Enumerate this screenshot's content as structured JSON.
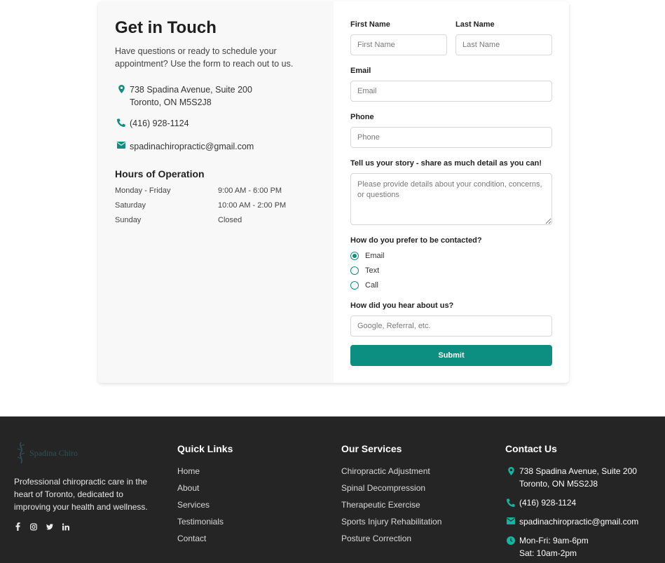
{
  "contact_info": {
    "title": "Get in Touch",
    "intro": "Have questions or ready to schedule your appointment? Use the form to reach out to us.",
    "address_line1": "738 Spadina Avenue, Suite 200",
    "address_line2": "Toronto, ON M5S2J8",
    "phone": "(416) 928-1124",
    "email": "spadinachiropractic@gmail.com",
    "hours_title": "Hours of Operation",
    "hours": [
      {
        "day": "Monday - Friday",
        "time": "9:00 AM - 6:00 PM"
      },
      {
        "day": "Saturday",
        "time": "10:00 AM - 2:00 PM"
      },
      {
        "day": "Sunday",
        "time": "Closed"
      }
    ],
    "icons": {
      "address": "map-pin-icon",
      "phone": "phone-icon",
      "email": "envelope-icon"
    }
  },
  "form": {
    "first_name": {
      "label": "First Name",
      "placeholder": "First Name",
      "value": ""
    },
    "last_name": {
      "label": "Last Name",
      "placeholder": "Last Name",
      "value": ""
    },
    "email": {
      "label": "Email",
      "placeholder": "Email",
      "value": ""
    },
    "phone": {
      "label": "Phone",
      "placeholder": "Phone",
      "value": ""
    },
    "story": {
      "label": "Tell us your story - share as much detail as you can!",
      "placeholder": "Please provide details about your condition, concerns, or questions",
      "value": ""
    },
    "contact_pref": {
      "label": "How do you prefer to be contacted?",
      "options": [
        "Email",
        "Text",
        "Call"
      ],
      "selected": "Email"
    },
    "referral": {
      "label": "How did you hear about us?",
      "placeholder": "Google, Referral, etc.",
      "value": ""
    },
    "submit_label": "Submit"
  },
  "footer": {
    "logo_text": "Spadina Chiro",
    "description": "Professional chiropractic care in the heart of Toronto, dedicated to improving your health and wellness.",
    "socials": [
      "facebook-icon",
      "instagram-icon",
      "twitter-icon",
      "linkedin-icon"
    ],
    "quick_links": {
      "title": "Quick Links",
      "items": [
        "Home",
        "About",
        "Services",
        "Testimonials",
        "Contact"
      ]
    },
    "services": {
      "title": "Our Services",
      "items": [
        "Chiropractic Adjustment",
        "Spinal Decompression",
        "Therapeutic Exercise",
        "Sports Injury Rehabilitation",
        "Posture Correction"
      ]
    },
    "contact": {
      "title": "Contact Us",
      "address_line1": "738 Spadina Avenue, Suite 200",
      "address_line2": "Toronto, ON M5S2J8",
      "phone": "(416) 928-1124",
      "email": "spadinachiropractic@gmail.com",
      "hours_line1": "Mon-Fri: 9am-6pm",
      "hours_line2": "Sat: 10am-2pm"
    }
  },
  "colors": {
    "accent": "#0c8f81",
    "footer_bg": "#252525",
    "card_left_bg": "#f8f8f8"
  }
}
